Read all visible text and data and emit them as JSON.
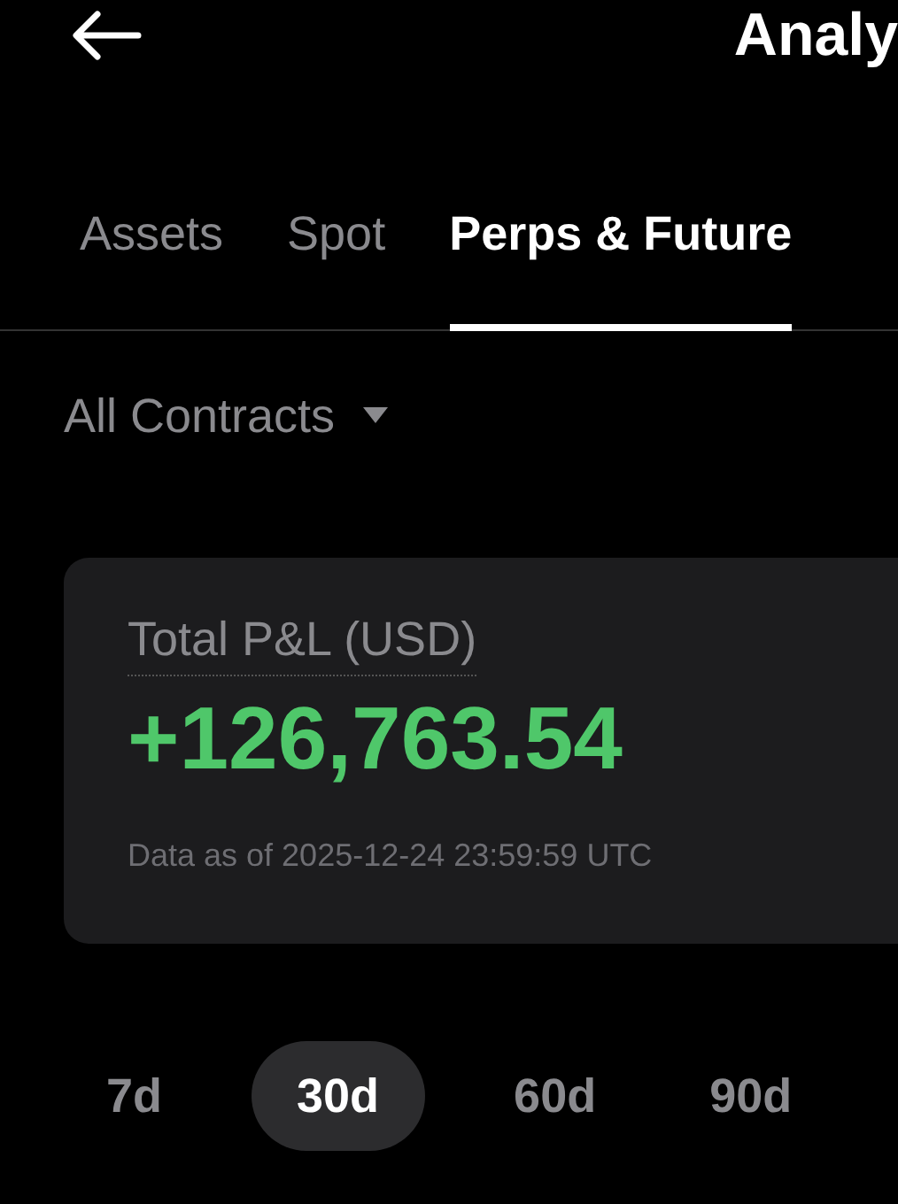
{
  "header": {
    "title": "Analy"
  },
  "tabs": [
    {
      "label": "Assets",
      "selected": false
    },
    {
      "label": "Spot",
      "selected": false
    },
    {
      "label": "Perps & Future",
      "selected": true
    }
  ],
  "filter": {
    "label": "All Contracts"
  },
  "summary": {
    "label": "Total P&L (USD)",
    "value": "+126,763.54",
    "note": "Data as of 2025-12-24 23:59:59 UTC"
  },
  "periods": [
    {
      "label": "7d",
      "selected": false
    },
    {
      "label": "30d",
      "selected": true
    },
    {
      "label": "60d",
      "selected": false
    },
    {
      "label": "90d",
      "selected": false
    }
  ]
}
